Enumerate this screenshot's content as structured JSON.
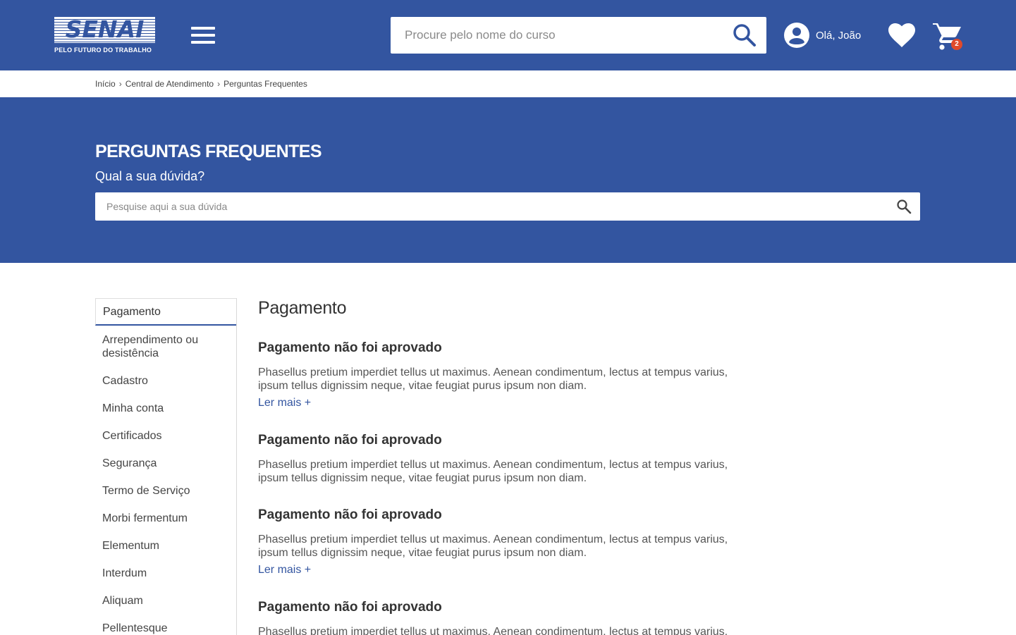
{
  "header": {
    "logo_text": "SENAI",
    "logo_tagline": "PELO FUTURO DO TRABALHO",
    "search_placeholder": "Procure pelo nome do curso",
    "user_greeting": "Olá, João",
    "cart_count": "2",
    "brand_color": "#3355a0",
    "badge_color": "#e04a2b"
  },
  "breadcrumb": [
    "Início",
    "Central de Atendimento",
    "Perguntas Frequentes"
  ],
  "hero": {
    "title": "PERGUNTAS FREQUENTES",
    "subtitle": "Qual a sua dúvida?",
    "search_placeholder": "Pesquise aqui a sua dúvida"
  },
  "sidebar": {
    "items": [
      "Pagamento",
      "Arrependimento ou desistência",
      "Cadastro",
      "Minha conta",
      "Certificados",
      "Segurança",
      "Termo de Serviço",
      "Morbi fermentum",
      "Elementum",
      "Interdum",
      "Aliquam",
      "Pellentesque"
    ],
    "active": "Pagamento"
  },
  "content": {
    "title": "Pagamento",
    "faqs": [
      {
        "question": "Pagamento não foi aprovado",
        "answer": "Phasellus pretium imperdiet tellus ut maximus. Aenean condimentum, lectus at tempus varius, ipsum tellus dignissim neque, vitae feugiat purus ipsum non diam.",
        "more": "Ler mais +"
      },
      {
        "question": "Pagamento não foi aprovado",
        "answer": "Phasellus pretium imperdiet tellus ut maximus. Aenean condimentum, lectus at tempus varius, ipsum tellus dignissim neque, vitae feugiat purus ipsum non diam."
      },
      {
        "question": "Pagamento não foi aprovado",
        "answer": "Phasellus pretium imperdiet tellus ut maximus. Aenean condimentum, lectus at tempus varius, ipsum tellus dignissim neque, vitae feugiat purus ipsum non diam.",
        "more": "Ler mais +"
      },
      {
        "question": "Pagamento não foi aprovado",
        "answer": "Phasellus pretium imperdiet tellus ut maximus. Aenean condimentum, lectus at tempus varius,"
      }
    ]
  }
}
